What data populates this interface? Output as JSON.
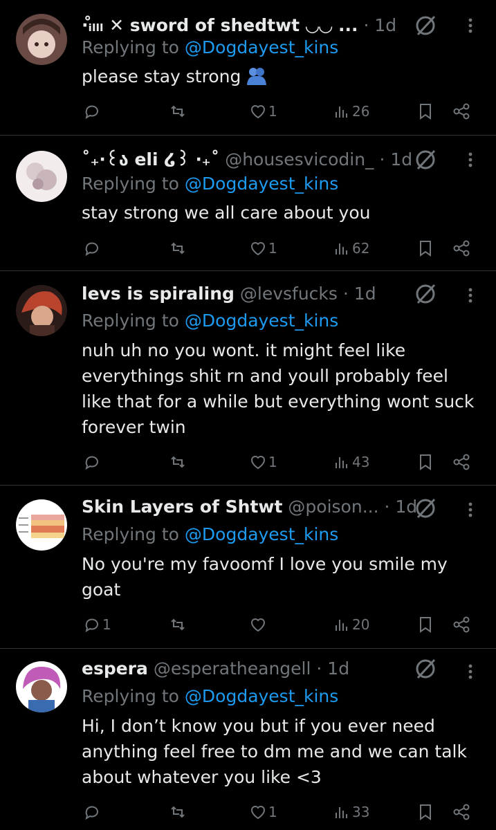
{
  "replies": [
    {
      "display_name": "·ᵢ̊ₗₗₗ ✕ sword of shedtwt ◡◡ ...",
      "handle": "",
      "time": "· 1d",
      "replying_label": "Replying to",
      "replying_to": "@Dogdayest_kins",
      "text": "please stay strong",
      "emoji": "people-hugging-emoji",
      "comments": "",
      "retweets": "",
      "likes": "1",
      "views": "26"
    },
    {
      "display_name": "˚₊‧꒰ა eli ໒꒱ ‧₊˚",
      "handle": "@housesvicodin_",
      "time": "· 1d",
      "replying_label": "Replying to",
      "replying_to": "@Dogdayest_kins",
      "text": "stay strong we all care about you",
      "comments": "",
      "retweets": "",
      "likes": "1",
      "views": "62"
    },
    {
      "display_name": "levs is spiraling",
      "handle": "@levsfucks",
      "time": "· 1d",
      "replying_label": "Replying to",
      "replying_to": "@Dogdayest_kins",
      "text": "nuh uh no you wont. it might feel like everythings shit rn and youll probably feel like that for a while but everything wont suck forever twin",
      "comments": "",
      "retweets": "",
      "likes": "1",
      "views": "43"
    },
    {
      "display_name": "Skin Layers of Shtwt",
      "handle": "@poison...",
      "time": "· 1d",
      "replying_label": "Replying to",
      "replying_to": "@Dogdayest_kins",
      "text": "No you're my favoomf I love you smile my goat",
      "comments": "1",
      "retweets": "",
      "likes": "",
      "views": "20"
    },
    {
      "display_name": "espera",
      "handle": "@esperatheangell",
      "time": "· 1d",
      "replying_label": "Replying to",
      "replying_to": "@Dogdayest_kins",
      "text": "Hi, I don’t know you but if you ever need anything feel free to dm me and we can talk about whatever you like <3",
      "comments": "",
      "retweets": "",
      "likes": "1",
      "views": "33"
    }
  ],
  "colors": {
    "background": "#000000",
    "text": "#e7e9ea",
    "muted": "#71767b",
    "link": "#1d9bf0",
    "divider": "#2f3336"
  },
  "icons": [
    "reply-icon",
    "retweet-icon",
    "like-icon",
    "views-icon",
    "bookmark-icon",
    "share-icon",
    "grok-icon",
    "more-icon"
  ]
}
